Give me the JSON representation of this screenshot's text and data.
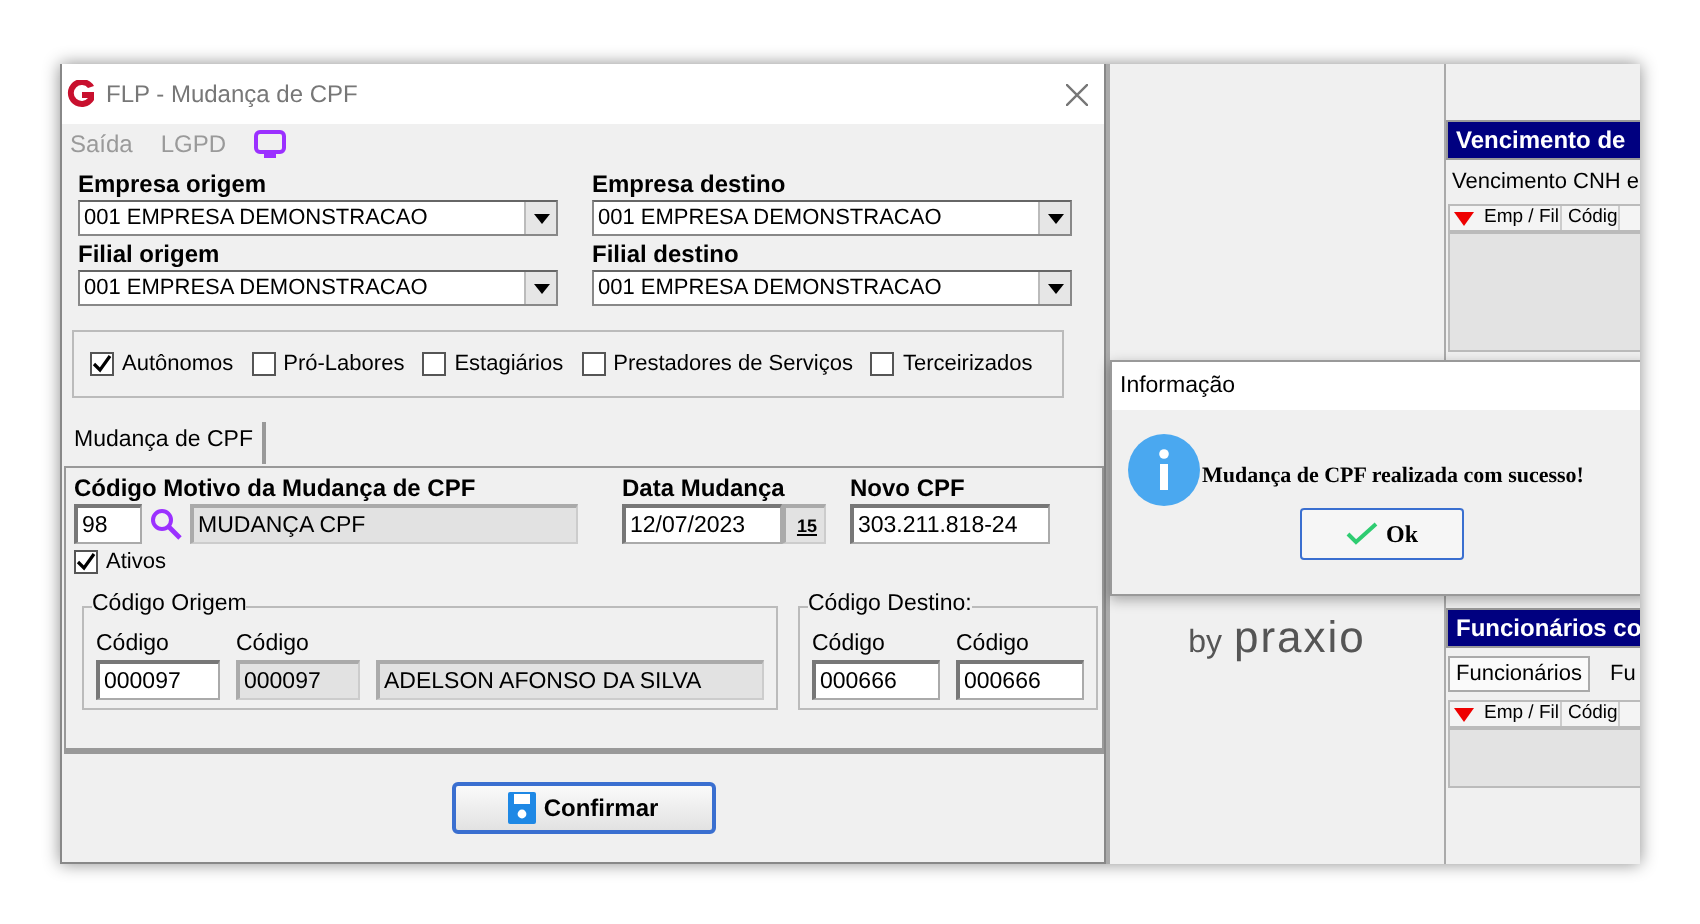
{
  "window": {
    "title": "FLP - Mudança de CPF"
  },
  "menu": [
    {
      "label": "Saída",
      "disabled": true
    },
    {
      "label": "LGPD",
      "disabled": true
    }
  ],
  "selects": [
    {
      "label": "Empresa origem",
      "value": "001 EMPRESA DEMONSTRACAO"
    },
    {
      "label": "Empresa destino",
      "value": "001 EMPRESA DEMONSTRACAO"
    },
    {
      "label": "Filial origem",
      "value": "001 EMPRESA DEMONSTRACAO"
    },
    {
      "label": "Filial destino",
      "value": "001 EMPRESA DEMONSTRACAO"
    }
  ],
  "categories": [
    {
      "label": "Autônomos",
      "checked": true
    },
    {
      "label": "Pró-Labores",
      "checked": false
    },
    {
      "label": "Estagiários",
      "checked": false
    },
    {
      "label": "Prestadores de Serviços",
      "checked": false
    },
    {
      "label": "Terceirizados",
      "checked": false
    }
  ],
  "tabs": [
    {
      "label": "Mudança de CPF",
      "selected": true
    }
  ],
  "reason": {
    "label": "Código Motivo da Mudança de CPF",
    "code": "98",
    "description": "MUDANÇA CPF"
  },
  "change_date": {
    "label": "Data Mudança",
    "value": "12/07/2023",
    "calendar_day": "15"
  },
  "new_cpf": {
    "label": "Novo CPF",
    "value": "303.211.818-24"
  },
  "active": {
    "label": "Ativos",
    "checked": true
  },
  "origin": {
    "title": "Código Origem",
    "fields": [
      {
        "label": "Código",
        "value": "000097",
        "readonly": false
      },
      {
        "label": "Código",
        "value": "000097",
        "readonly": true
      },
      {
        "value": "ADELSON AFONSO DA SILVA",
        "readonly": true
      }
    ]
  },
  "destination": {
    "title": "Código Destino:",
    "fields": [
      {
        "label": "Código",
        "value": "000666",
        "readonly": false
      },
      {
        "label": "Código",
        "value": "000666",
        "readonly": false
      }
    ]
  },
  "confirm_button": "Confirmar",
  "background": {
    "tagline": "by",
    "brand": "praxio",
    "panels": [
      {
        "title": "Vencimento de",
        "subtitle": "Vencimento CNH e",
        "columns": [
          "Emp / Fil",
          "Códig"
        ]
      },
      {
        "title": "Funcionários co",
        "tabs": [
          {
            "label": "Funcionários",
            "selected": true
          },
          {
            "label": "Fu",
            "selected": false
          }
        ],
        "columns": [
          "Emp / Fil",
          "Códig"
        ]
      }
    ]
  },
  "info_dialog": {
    "title": "Informação",
    "message": "Mudança de CPF realizada com sucesso!",
    "button": "Ok"
  }
}
